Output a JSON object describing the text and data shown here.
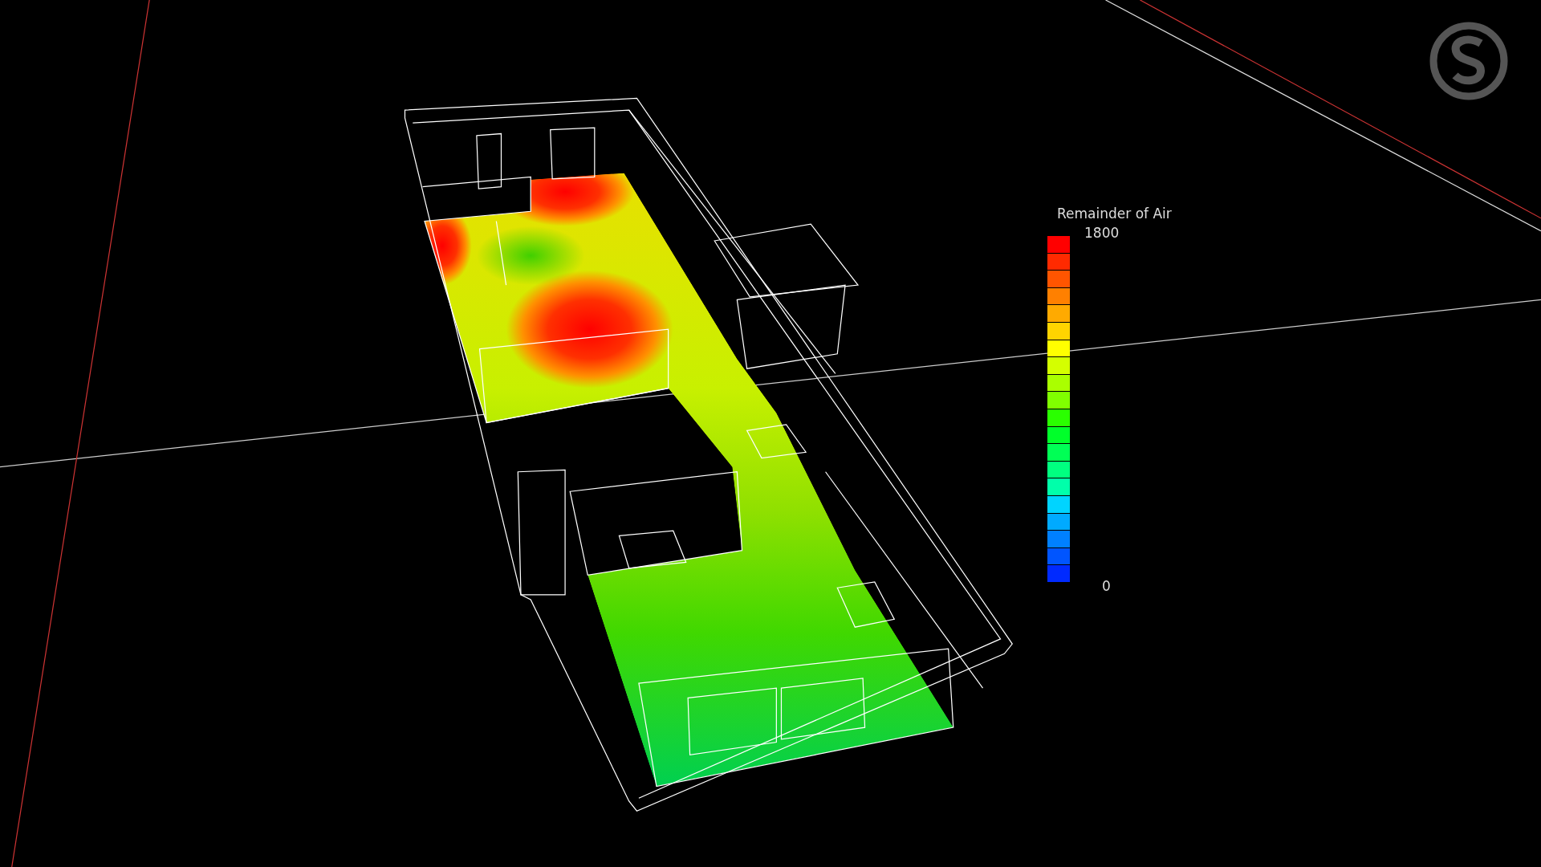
{
  "viewport": {
    "legend": {
      "title": "Remainder of Air",
      "max_label": "1800",
      "min_label": "0"
    }
  }
}
